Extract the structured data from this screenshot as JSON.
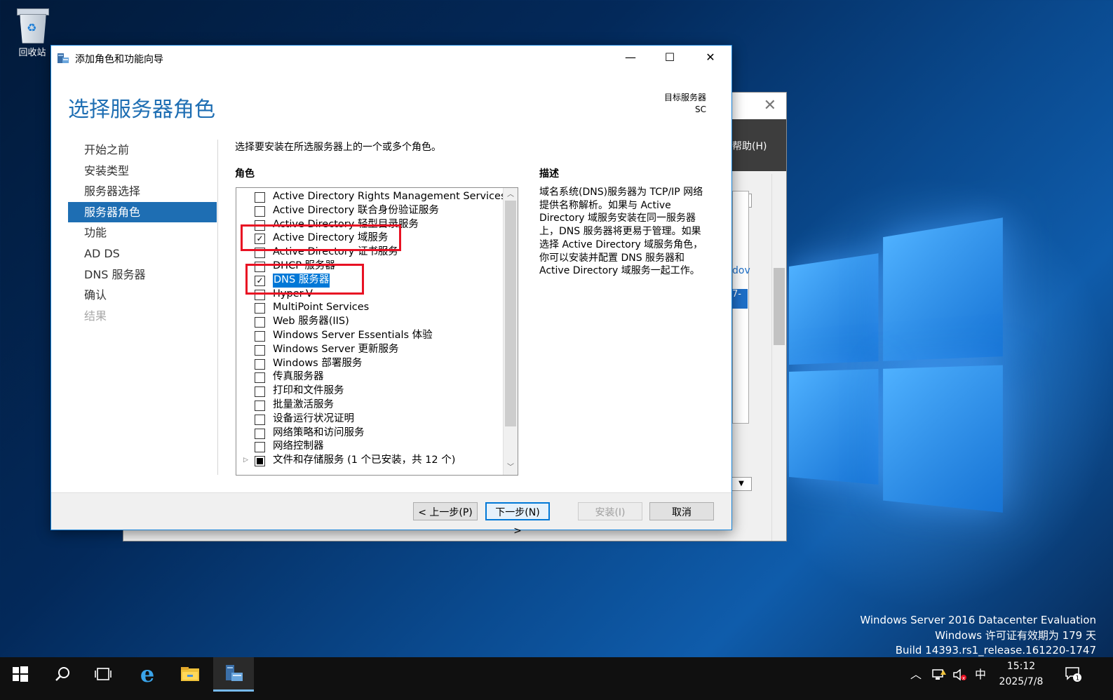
{
  "desktop": {
    "recycle_bin_label": "回收站",
    "watermark": [
      "Windows Server 2016 Datacenter Evaluation",
      "Windows 许可证有效期为 179 天",
      "Build 14393.rs1_release.161220-1747"
    ]
  },
  "background_window": {
    "menu_help": "帮助(H)",
    "link_fragment": "dov",
    "blue_fragment": "7-",
    "close_icon": "close-icon"
  },
  "dialog": {
    "title": "添加角色和功能向导",
    "heading": "选择服务器角色",
    "target_label": "目标服务器",
    "target_value": "SC",
    "nav": [
      {
        "label": "开始之前",
        "state": "normal"
      },
      {
        "label": "安装类型",
        "state": "normal"
      },
      {
        "label": "服务器选择",
        "state": "normal"
      },
      {
        "label": "服务器角色",
        "state": "active"
      },
      {
        "label": "功能",
        "state": "normal"
      },
      {
        "label": "AD DS",
        "state": "normal"
      },
      {
        "label": "DNS 服务器",
        "state": "normal"
      },
      {
        "label": "确认",
        "state": "normal"
      },
      {
        "label": "结果",
        "state": "disabled"
      }
    ],
    "instruction": "选择要安装在所选服务器上的一个或多个角色。",
    "roles_label": "角色",
    "description_label": "描述",
    "description": "域名系统(DNS)服务器为 TCP/IP 网络提供名称解析。如果与 Active Directory 域服务安装在同一服务器上，DNS 服务器将更易于管理。如果选择 Active Directory 域服务角色，你可以安装并配置 DNS 服务器和 Active Directory 域服务一起工作。",
    "roles": [
      {
        "label": "Active Directory Rights Management Services",
        "checked": false
      },
      {
        "label": "Active Directory 联合身份验证服务",
        "checked": false
      },
      {
        "label": "Active Directory 轻型目录服务",
        "checked": false
      },
      {
        "label": "Active Directory 域服务",
        "checked": true
      },
      {
        "label": "Active Directory 证书服务",
        "checked": false
      },
      {
        "label": "DHCP 服务器",
        "checked": false
      },
      {
        "label": "DNS 服务器",
        "checked": true,
        "selected": true
      },
      {
        "label": "Hyper-V",
        "checked": false
      },
      {
        "label": "MultiPoint Services",
        "checked": false
      },
      {
        "label": "Web 服务器(IIS)",
        "checked": false
      },
      {
        "label": "Windows Server Essentials 体验",
        "checked": false
      },
      {
        "label": "Windows Server 更新服务",
        "checked": false
      },
      {
        "label": "Windows 部署服务",
        "checked": false
      },
      {
        "label": "传真服务器",
        "checked": false
      },
      {
        "label": "打印和文件服务",
        "checked": false
      },
      {
        "label": "批量激活服务",
        "checked": false
      },
      {
        "label": "设备运行状况证明",
        "checked": false
      },
      {
        "label": "网络策略和访问服务",
        "checked": false
      },
      {
        "label": "网络控制器",
        "checked": false
      },
      {
        "label": "文件和存储服务 (1 个已安装，共 12 个)",
        "checked": "partial",
        "expandable": true
      }
    ],
    "buttons": {
      "prev": "< 上一步(P)",
      "next": "下一步(N) >",
      "install": "安装(I)",
      "cancel": "取消"
    },
    "window_controls": {
      "minimize": "—",
      "maximize": "☐",
      "close": "✕"
    },
    "highlight_color": "#e81123",
    "accent_color": "#1e6eb3"
  },
  "taskbar": {
    "time": "15:12",
    "date": "2025/7/8",
    "ime": "中",
    "notification_count": "1",
    "items": [
      "start-icon",
      "search-icon",
      "task-view-icon",
      "ie-icon",
      "file-explorer-icon",
      "server-manager-icon"
    ]
  }
}
